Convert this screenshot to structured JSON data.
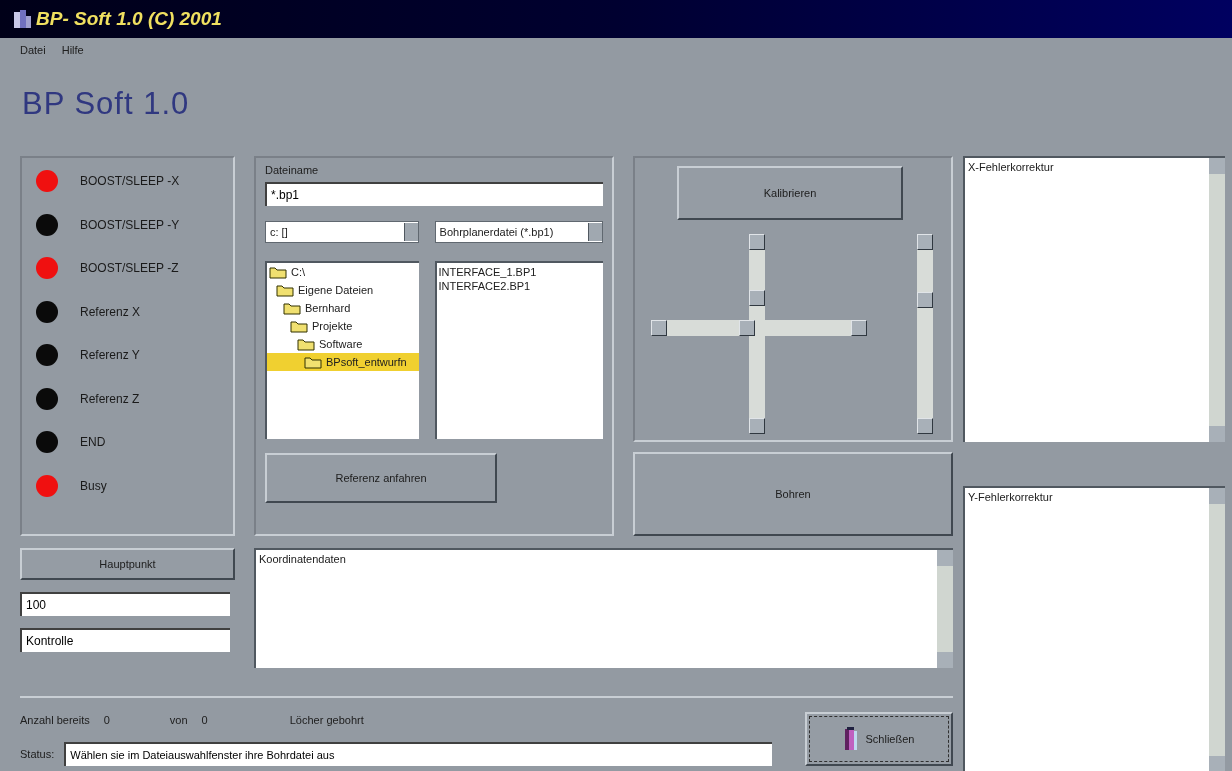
{
  "window": {
    "title": "BP- Soft 1.0 (C) 2001"
  },
  "menu": [
    {
      "label": "Datei"
    },
    {
      "label": "Hilfe"
    }
  ],
  "heading": "BP  Soft 1.0",
  "indicators": [
    {
      "label": "BOOST/SLEEP -X",
      "on": true
    },
    {
      "label": "BOOST/SLEEP -Y",
      "on": false
    },
    {
      "label": "BOOST/SLEEP -Z",
      "on": true
    },
    {
      "label": "Referenz X",
      "on": false
    },
    {
      "label": "Referenz Y",
      "on": false
    },
    {
      "label": "Referenz Z",
      "on": false
    },
    {
      "label": "END",
      "on": false
    },
    {
      "label": "Busy",
      "on": true
    }
  ],
  "file_panel": {
    "label": "Dateiname",
    "filename": "*.bp1",
    "drive": "c: []",
    "filter": "Bohrplanerdatei (*.bp1)",
    "folders": [
      {
        "label": "C:\\",
        "selected": false,
        "children": [
          {
            "label": "Eigene Dateien",
            "selected": false,
            "children": [
              {
                "label": "Bernhard",
                "selected": false,
                "children": [
                  {
                    "label": "Projekte",
                    "selected": false,
                    "children": [
                      {
                        "label": "Software",
                        "selected": false,
                        "children": [
                          {
                            "label": "BPsoft_entwurfn",
                            "selected": true
                          }
                        ]
                      }
                    ]
                  }
                ]
              }
            ]
          }
        ]
      }
    ],
    "files": [
      "INTERFACE_1.BP1",
      "INTERFACE2.BP1"
    ],
    "button": "Referenz anfahren"
  },
  "calibrate_button": "Kalibrieren",
  "x_slider": {
    "level": 0.43
  },
  "drill_button": "Bohren",
  "main_point_button": "Hauptpunkt",
  "value_field": "100",
  "check_field": "Kontrolle",
  "coordinates_box": "Koordinatendaten",
  "x_correction_box": "X-Fehlerkorrektur",
  "y_correction_box": "Y-Fehlerkorrektur",
  "counters": [
    {
      "label": "Anzahl bereits",
      "value": "0"
    },
    {
      "label": "von",
      "value": "0"
    }
  ],
  "holes_label": "Löcher gebohrt",
  "status": {
    "label": "Status:",
    "value": "Wählen sie im Dateiauswahlfenster ihre Bohrdatei aus"
  },
  "close_button": "Schließen"
}
